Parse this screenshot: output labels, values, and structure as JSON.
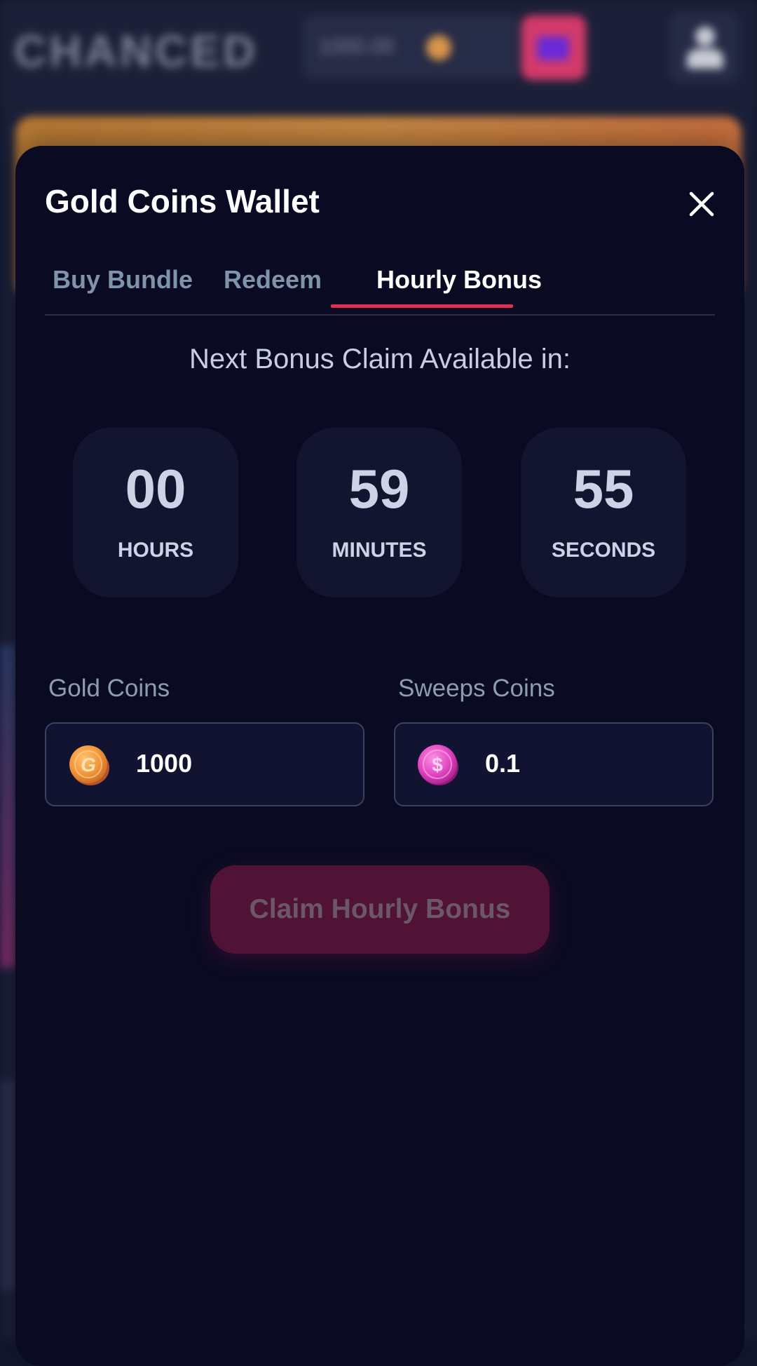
{
  "background": {
    "logo_text": "CHANCED",
    "balance_text": "1000.00"
  },
  "modal": {
    "title": "Gold Coins Wallet",
    "tabs": [
      {
        "label": "Buy Bundle",
        "active": false
      },
      {
        "label": "Redeem",
        "active": false
      },
      {
        "label": "Hourly Bonus",
        "active": true
      }
    ],
    "next_claim_text": "Next Bonus Claim Available in:",
    "timer": {
      "hours": {
        "value": "00",
        "label": "HOURS"
      },
      "minutes": {
        "value": "59",
        "label": "MINUTES"
      },
      "seconds": {
        "value": "55",
        "label": "SECONDS"
      }
    },
    "gold_coins": {
      "label": "Gold Coins",
      "value": "1000",
      "icon": "gold-coin-icon"
    },
    "sweeps_coins": {
      "label": "Sweeps Coins",
      "value": "0.1",
      "icon": "sweeps-coin-icon"
    },
    "claim_button": {
      "label": "Claim Hourly Bonus",
      "enabled": false
    }
  },
  "colors": {
    "accent": "#e0304f",
    "modal_bg": "#0a0b22",
    "box_bg": "#131530",
    "claim_disabled_bg": "#511335"
  }
}
